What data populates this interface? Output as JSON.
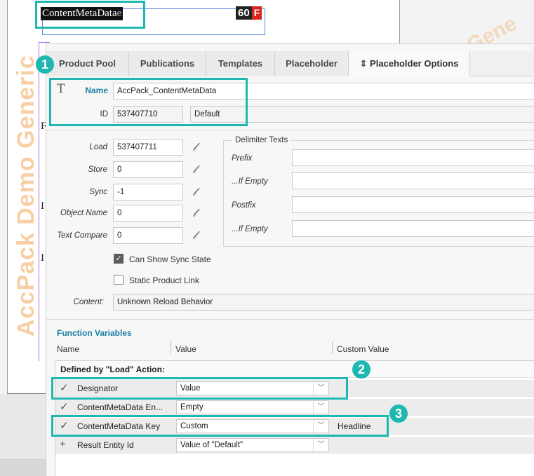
{
  "document": {
    "selected_text": "ContentMetaData",
    "selected_text_tail": "e",
    "badge_number": "60",
    "badge_flag": "F",
    "letters": [
      "F",
      "I",
      "I"
    ],
    "watermark": "AccPack Demo Generic",
    "watermark2": "Gene"
  },
  "tabs": [
    {
      "label": "Product Pool"
    },
    {
      "label": "Publications"
    },
    {
      "label": "Templates"
    },
    {
      "label": "Placeholder"
    },
    {
      "label": "⇕ Placeholder Options"
    }
  ],
  "identity": {
    "name_label": "Name",
    "name_value": "AccPack_ContentMetaData",
    "id_label": "ID",
    "id_value": "537407710",
    "id_default": "Default"
  },
  "actions": [
    {
      "label": "Load",
      "value": "537407711"
    },
    {
      "label": "Store",
      "value": "0"
    },
    {
      "label": "Sync",
      "value": "-1"
    },
    {
      "label": "Object Name",
      "value": "0"
    },
    {
      "label": "Text Compare",
      "value": "0"
    }
  ],
  "delimiter": {
    "title": "Delimiter Texts",
    "prefix_label": "Prefix",
    "prefix_empty_label": "...If Empty",
    "postfix_label": "Postfix",
    "postfix_empty_label": "...If Empty"
  },
  "checkboxes": [
    {
      "label": "Can Show Sync State",
      "checked": true
    },
    {
      "label": "Static Product Link",
      "checked": false
    }
  ],
  "content": {
    "label": "Content:",
    "value": "Unknown Reload Behavior"
  },
  "function_variables": {
    "title": "Function Variables",
    "col_name": "Name",
    "col_value": "Value",
    "col_custom": "Custom Value",
    "group_header": "Defined by \"Load\" Action:",
    "rows": [
      {
        "mark": "✓",
        "name": "Designator",
        "value": "Value",
        "custom": ""
      },
      {
        "mark": "✓",
        "name": "ContentMetaData En...",
        "value": "Empty",
        "custom": ""
      },
      {
        "mark": "✓",
        "name": "ContentMetaData Key",
        "value": "Custom",
        "custom": "Headline"
      },
      {
        "mark": "+",
        "name": "Result Entity Id",
        "value": "Value of \"Default\"",
        "custom": ""
      }
    ]
  },
  "callouts": [
    "1",
    "2",
    "3"
  ],
  "colors": {
    "accent": "#1fb8b0",
    "label_blue": "#1a7fa3",
    "watermark": "#f2a85a",
    "badge_red": "#d9261c"
  }
}
